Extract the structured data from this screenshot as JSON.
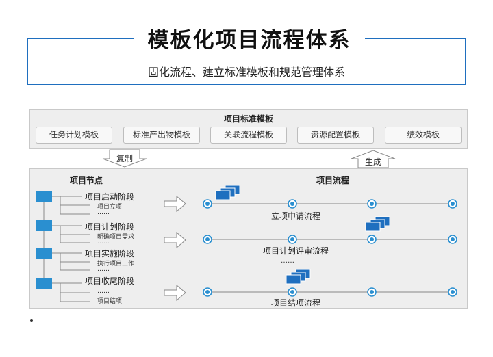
{
  "header": {
    "title": "模板化项目流程体系",
    "subtitle": "固化流程、建立标准模板和规范管理体系"
  },
  "templates": {
    "title": "项目标准模板",
    "items": [
      "任务计划模板",
      "标准产出物模板",
      "关联流程模板",
      "资源配置模板",
      "绩效模板"
    ]
  },
  "arrows": {
    "copy": "复制",
    "generate": "生成"
  },
  "nodes": {
    "title": "项目节点",
    "stages": [
      {
        "label": "项目启动阶段",
        "subs": [
          "项目立项",
          "……"
        ]
      },
      {
        "label": "项目计划阶段",
        "subs": [
          "明确项目需求",
          "……"
        ]
      },
      {
        "label": "项目实施阶段",
        "subs": [
          "执行项目工作",
          "……"
        ]
      },
      {
        "label": "项目收尾阶段",
        "subs": [
          "……",
          "项目结项"
        ]
      }
    ]
  },
  "flows": {
    "title": "项目流程",
    "items": [
      "立项申请流程",
      "项目计划评审流程",
      "项目结项流程"
    ],
    "ellipsis": "……"
  },
  "colors": {
    "accent": "#1f6fbf",
    "node": "#2a8fd0",
    "docs": "#1f6fbf"
  }
}
